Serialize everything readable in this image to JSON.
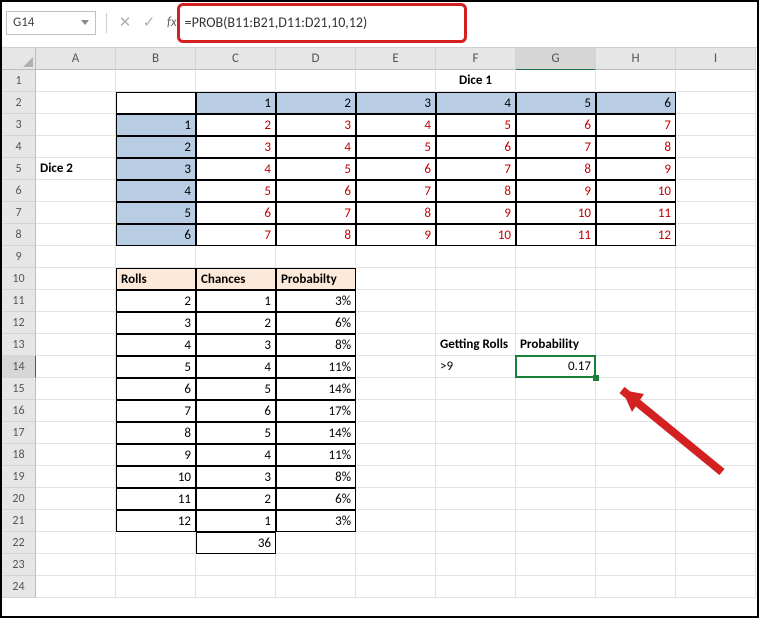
{
  "name_box": "G14",
  "formula": "=PROB(B11:B21,D11:D21,10,12)",
  "cols": [
    "A",
    "B",
    "C",
    "D",
    "E",
    "F",
    "G",
    "H",
    "I"
  ],
  "rows": [
    "1",
    "2",
    "3",
    "4",
    "5",
    "6",
    "7",
    "8",
    "9",
    "10",
    "11",
    "12",
    "13",
    "14",
    "15",
    "16",
    "17",
    "18",
    "19",
    "20",
    "21",
    "22",
    "23",
    "24"
  ],
  "dice1_label": "Dice 1",
  "dice2_label": "Dice 2",
  "dice_col_headers": [
    "1",
    "2",
    "3",
    "4",
    "5",
    "6"
  ],
  "dice_row_headers": [
    "1",
    "2",
    "3",
    "4",
    "5",
    "6"
  ],
  "dice_sums": [
    [
      "2",
      "3",
      "4",
      "5",
      "6",
      "7"
    ],
    [
      "3",
      "4",
      "5",
      "6",
      "7",
      "8"
    ],
    [
      "4",
      "5",
      "6",
      "7",
      "8",
      "9"
    ],
    [
      "5",
      "6",
      "7",
      "8",
      "9",
      "10"
    ],
    [
      "6",
      "7",
      "8",
      "9",
      "10",
      "11"
    ],
    [
      "7",
      "8",
      "9",
      "10",
      "11",
      "12"
    ]
  ],
  "rolls_header": {
    "rolls": "Rolls",
    "chances": "Chances",
    "prob": "Probabilty"
  },
  "rolls_table": [
    {
      "r": "2",
      "c": "1",
      "p": "3%"
    },
    {
      "r": "3",
      "c": "2",
      "p": "6%"
    },
    {
      "r": "4",
      "c": "3",
      "p": "8%"
    },
    {
      "r": "5",
      "c": "4",
      "p": "11%"
    },
    {
      "r": "6",
      "c": "5",
      "p": "14%"
    },
    {
      "r": "7",
      "c": "6",
      "p": "17%"
    },
    {
      "r": "8",
      "c": "5",
      "p": "14%"
    },
    {
      "r": "9",
      "c": "4",
      "p": "11%"
    },
    {
      "r": "10",
      "c": "3",
      "p": "8%"
    },
    {
      "r": "11",
      "c": "2",
      "p": "6%"
    },
    {
      "r": "12",
      "c": "1",
      "p": "3%"
    }
  ],
  "chances_total": "36",
  "side": {
    "getting_rolls_label": "Getting Rolls",
    "prob_label": "Probability",
    "condition": ">9",
    "value": "0.17"
  }
}
